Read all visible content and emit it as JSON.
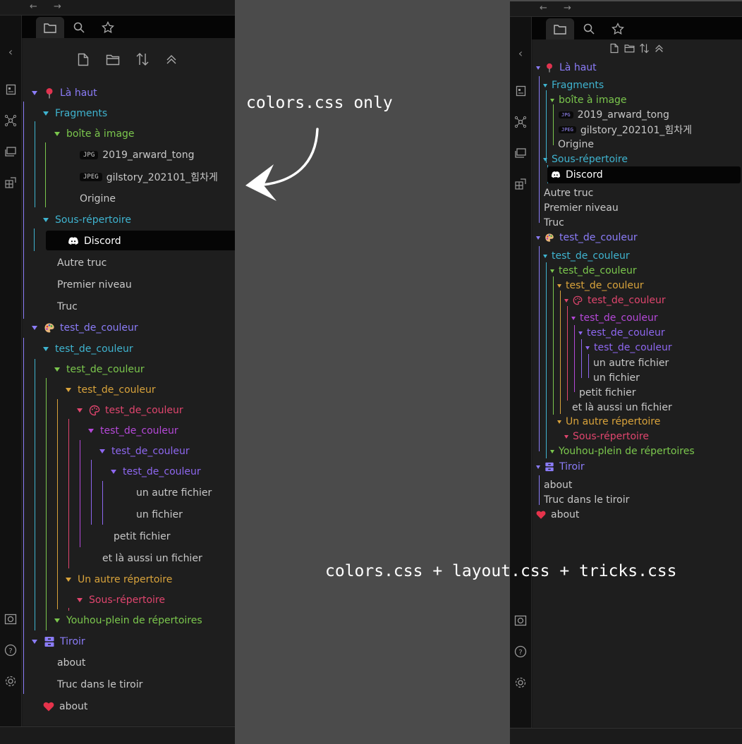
{
  "annotations": {
    "left": "colors.css only",
    "right": "colors.css + layout.css + tricks.css"
  },
  "window": {
    "back_arrow": "←",
    "forward_arrow": "→"
  },
  "colors": {
    "purple": "#8b7cf8",
    "cyan": "#3fb4d0",
    "green": "#7bc74d",
    "orange": "#d9a33b",
    "pink": "#e0456e",
    "magenta": "#b548d8",
    "violet": "#8e67f0",
    "file": "#c8c8c8",
    "white": "#ffffff"
  },
  "tree": [
    {
      "label": "Là haut",
      "icon": "pin-icon",
      "kind": "folder",
      "color": "purple"
    },
    {
      "label": "Fragments",
      "kind": "folder",
      "color": "cyan"
    },
    {
      "label": "boîte à image",
      "kind": "folder",
      "color": "green"
    },
    {
      "label": "2019_arward_tong",
      "badge": "JPG",
      "kind": "file"
    },
    {
      "label": "gilstory_202101_힘차게",
      "badge": "JPEG",
      "kind": "file"
    },
    {
      "label": "Origine",
      "kind": "file"
    },
    {
      "label": "Sous-répertoire",
      "kind": "folder",
      "color": "cyan"
    },
    {
      "label": "Discord",
      "icon": "discord-icon",
      "kind": "file",
      "selected": true
    },
    {
      "label": "Autre truc",
      "kind": "file"
    },
    {
      "label": "Premier niveau",
      "kind": "file"
    },
    {
      "label": "Truc",
      "kind": "file"
    },
    {
      "label": "test_de_couleur",
      "icon": "palette-icon",
      "kind": "folder",
      "color": "purple"
    },
    {
      "label": "test_de_couleur",
      "kind": "folder",
      "color": "cyan"
    },
    {
      "label": "test_de_couleur",
      "kind": "folder",
      "color": "green"
    },
    {
      "label": "test_de_couleur",
      "kind": "folder",
      "color": "orange"
    },
    {
      "label": "test_de_couleur",
      "icon": "palette-outline-icon",
      "kind": "folder",
      "color": "pink"
    },
    {
      "label": "test_de_couleur",
      "kind": "folder",
      "color": "magenta"
    },
    {
      "label": "test_de_couleur",
      "kind": "folder",
      "color": "violet"
    },
    {
      "label": "test_de_couleur",
      "kind": "folder",
      "color": "violet"
    },
    {
      "label": "un autre fichier",
      "kind": "file"
    },
    {
      "label": "un fichier",
      "kind": "file"
    },
    {
      "label": "petit fichier",
      "kind": "file"
    },
    {
      "label": "et là aussi un fichier",
      "kind": "file"
    },
    {
      "label": "Un autre répertoire",
      "kind": "folder",
      "color": "orange"
    },
    {
      "label": "Sous-répertoire",
      "kind": "folder",
      "color": "pink"
    },
    {
      "label": "Youhou-plein de répertoires",
      "kind": "folder",
      "color": "green"
    },
    {
      "label": "Tiroir",
      "icon": "drawer-icon",
      "kind": "folder",
      "color": "purple"
    },
    {
      "label": "about",
      "kind": "file"
    },
    {
      "label": "Truc dans le tiroir",
      "kind": "file"
    },
    {
      "label": "about",
      "icon": "heart-icon",
      "kind": "file"
    }
  ]
}
